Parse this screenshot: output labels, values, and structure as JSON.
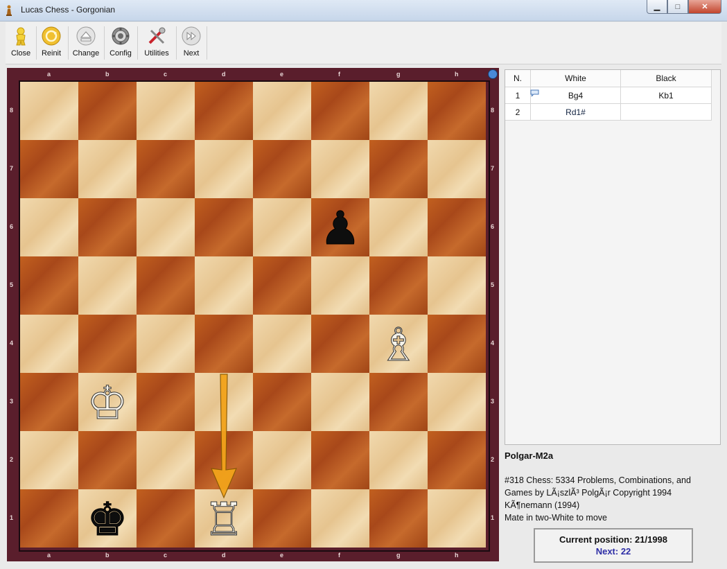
{
  "window": {
    "title": "Lucas Chess - Gorgonian",
    "minimize": "▁",
    "maximize": "□",
    "close": "✕"
  },
  "toolbar": {
    "items": [
      {
        "label": "Close",
        "icon": "close-person-icon"
      },
      {
        "label": "Reinit",
        "icon": "reinit-icon"
      },
      {
        "label": "Change",
        "icon": "change-icon"
      },
      {
        "label": "Config",
        "icon": "config-gear-icon"
      },
      {
        "label": "Utilities",
        "icon": "utilities-tools-icon"
      },
      {
        "label": "Next",
        "icon": "next-icon"
      }
    ]
  },
  "board": {
    "files": [
      "a",
      "b",
      "c",
      "d",
      "e",
      "f",
      "g",
      "h"
    ],
    "ranks": [
      "8",
      "7",
      "6",
      "5",
      "4",
      "3",
      "2",
      "1"
    ],
    "pieces": [
      {
        "square": "f6",
        "piece": "black-pawn",
        "glyph": "♟"
      },
      {
        "square": "g4",
        "piece": "white-bishop",
        "glyph": "♗"
      },
      {
        "square": "b3",
        "piece": "white-king",
        "glyph": "♔"
      },
      {
        "square": "d1",
        "piece": "white-rook",
        "glyph": "♖"
      },
      {
        "square": "b1",
        "piece": "black-king",
        "glyph": "♚"
      }
    ],
    "last_move_arrow": {
      "from": "d3",
      "to": "d1",
      "color": "#f2a31b"
    },
    "side_to_move_indicator": "#4a8ad8"
  },
  "moves": {
    "headers": {
      "num": "N.",
      "white": "White",
      "black": "Black"
    },
    "rows": [
      {
        "num": "1",
        "white": "Bg4",
        "black": "Kb1",
        "comment": true
      },
      {
        "num": "2",
        "white": "Rd1#",
        "black": "",
        "selected": "white"
      }
    ]
  },
  "game": {
    "title": "Polgar-M2a",
    "description_lines": [
      "#318 Chess: 5334 Problems, Combinations, and",
      "Games by LÃ¡szlÃ³ PolgÃ¡r Copyright 1994",
      "KÃ¶nemann (1994)",
      "Mate in two-White to move"
    ]
  },
  "position": {
    "current": "Current position: 21/1998",
    "next": "Next: 22"
  }
}
